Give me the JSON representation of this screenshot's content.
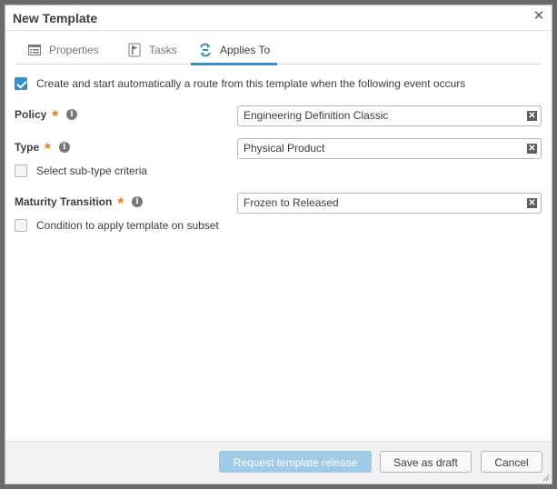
{
  "dialog": {
    "title": "New Template",
    "close_icon": "close-icon"
  },
  "tabs": [
    {
      "label": "Properties",
      "icon": "properties-icon",
      "active": false
    },
    {
      "label": "Tasks",
      "icon": "tasks-flag-icon",
      "active": false
    },
    {
      "label": "Applies To",
      "icon": "route-icon",
      "active": true
    }
  ],
  "auto_route": {
    "label": "Create and start automatically a route from this template when the following event occurs",
    "checked": true
  },
  "fields": {
    "policy": {
      "label": "Policy",
      "value": "Engineering Definition Classic",
      "required": true
    },
    "type": {
      "label": "Type",
      "value": "Physical Product",
      "required": true
    },
    "maturity": {
      "label": "Maturity Transition",
      "value": "Frozen to Released",
      "required": true
    }
  },
  "subtype": {
    "label": "Select sub-type criteria",
    "checked": false
  },
  "subset": {
    "label": "Condition to apply template on subset",
    "checked": false
  },
  "footer": {
    "request_release": "Request template release",
    "save_draft": "Save as draft",
    "cancel": "Cancel"
  },
  "colors": {
    "accent": "#368ec4",
    "required": "#e87b00",
    "disabled_primary": "#9fcbe6"
  }
}
